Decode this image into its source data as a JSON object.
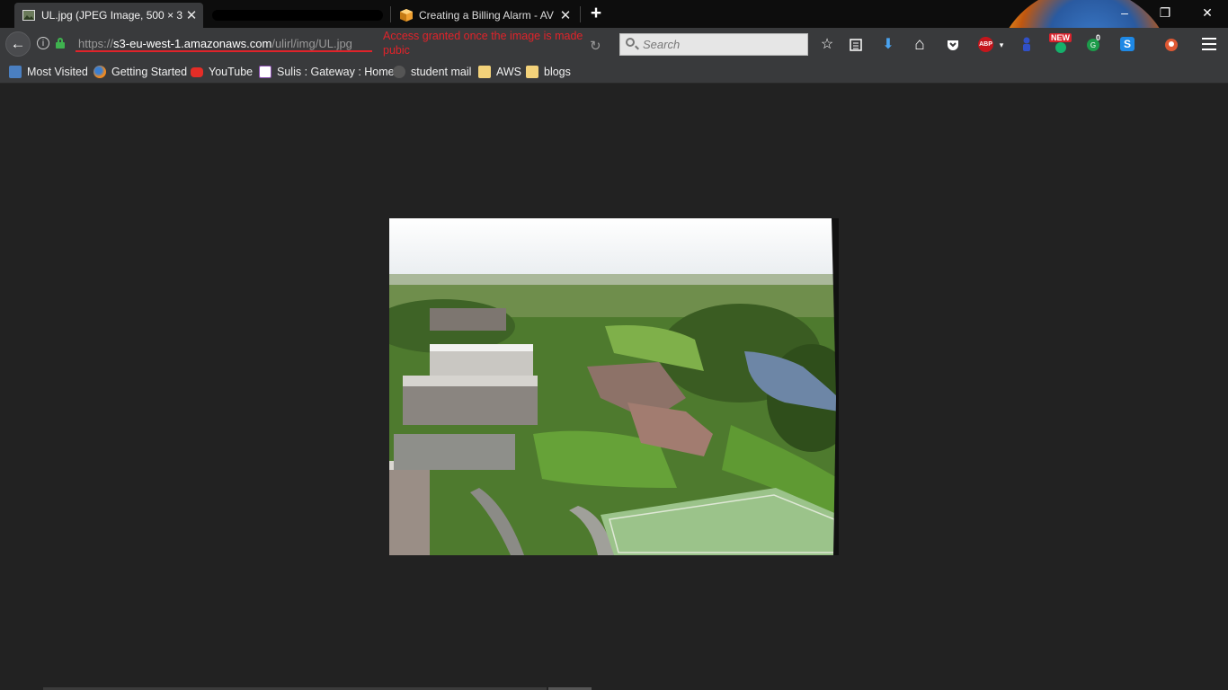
{
  "browser": {
    "tabs": [
      {
        "title": "UL.jpg (JPEG Image, 500 × 3",
        "active": true
      },
      {
        "title": "Creating a Billing Alarm - AV",
        "active": false
      }
    ],
    "new_tab_label": "+",
    "window_controls": {
      "minimize": "‒",
      "restore": "❐",
      "close": "✕"
    }
  },
  "navbar": {
    "back_label": "←",
    "url": {
      "scheme": "https://",
      "host": "s3-eu-west-1.amazonaws.com",
      "path": "/ulirl/img/UL.jpg"
    },
    "annotation": "Access granted once the image is made pubic",
    "annotation_color": "#e0232a",
    "search_placeholder": "Search",
    "toolbar": {
      "star": "☆",
      "download": "⬇",
      "home": "⌂",
      "abp": "ABP",
      "new_badge": "NEW",
      "count_badge": "0",
      "skype": "S"
    }
  },
  "bookmarks": [
    {
      "label": "Most Visited",
      "icon": "most-visited-icon"
    },
    {
      "label": "Getting Started",
      "icon": "firefox-icon"
    },
    {
      "label": "YouTube",
      "icon": "youtube-icon"
    },
    {
      "label": "Sulis : Gateway : Home",
      "icon": "sulis-icon"
    },
    {
      "label": "student mail",
      "icon": "globe-icon"
    },
    {
      "label": "AWS",
      "icon": "folder-icon"
    },
    {
      "label": "blogs",
      "icon": "folder-icon"
    }
  ],
  "content": {
    "image_alt": "UL.jpg",
    "background": "#222222"
  }
}
